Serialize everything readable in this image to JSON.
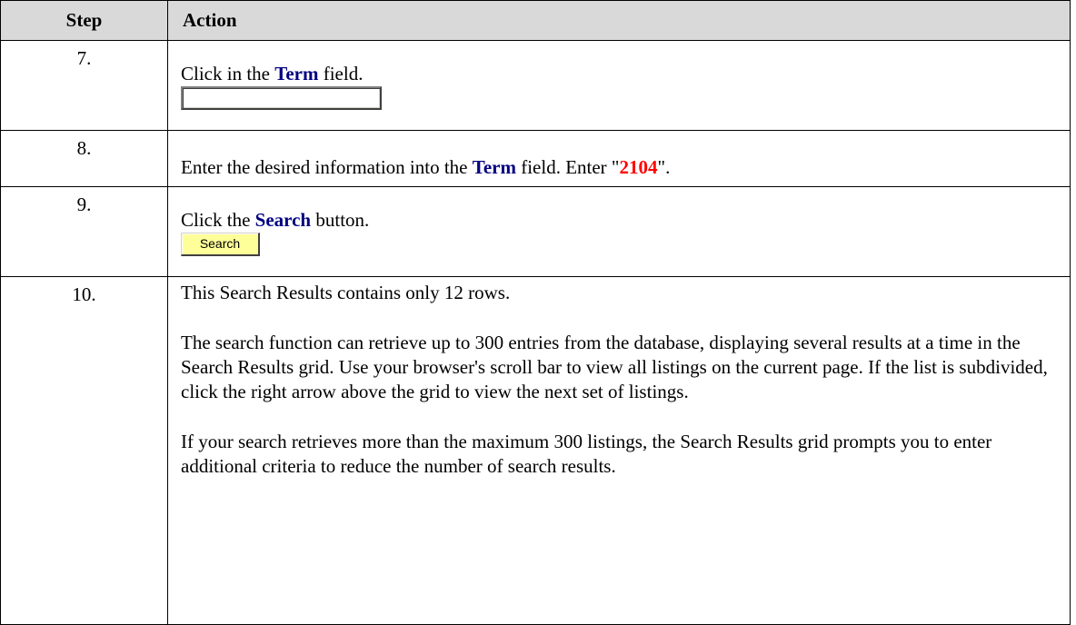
{
  "headers": {
    "step": "Step",
    "action": "Action"
  },
  "rows": [
    {
      "step": "7.",
      "pre": "Click in the ",
      "keyword": "Term",
      "post": " field."
    },
    {
      "step": "8.",
      "pre": "Enter the desired information into the ",
      "keyword": "Term",
      "mid": " field. Enter \"",
      "value": "2104",
      "post": "\"."
    },
    {
      "step": "9.",
      "pre": "Click the ",
      "keyword": "Search",
      "post": " button.",
      "button_label": "Search"
    },
    {
      "step": "10.",
      "p1": "This Search Results contains only 12 rows.",
      "p2": "The search function can retrieve up to 300 entries from the database, displaying several results at a time in the Search Results grid.  Use your browser's scroll bar to view all listings on the current page.  If the list is subdivided, click the right arrow above the grid to view the next set of listings.",
      "p3": "If your search retrieves more than the maximum 300 listings, the Search Results grid prompts you to enter additional criteria to reduce the number of search results."
    }
  ],
  "colors": {
    "header_bg": "#d9d9d9",
    "keyword": "#000080",
    "value": "#ff0000",
    "button_bg": "#ffff99"
  }
}
